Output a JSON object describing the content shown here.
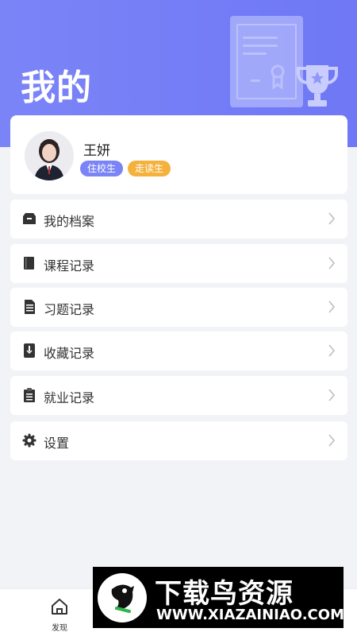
{
  "header": {
    "title": "我的"
  },
  "profile": {
    "name": "王妍",
    "badges": [
      "住校生",
      "走读生"
    ]
  },
  "menu": [
    {
      "label": "我的档案",
      "icon": "archive-box-icon"
    },
    {
      "label": "课程记录",
      "icon": "book-icon"
    },
    {
      "label": "习题记录",
      "icon": "document-list-icon"
    },
    {
      "label": "收藏记录",
      "icon": "bookmark-icon"
    },
    {
      "label": "就业记录",
      "icon": "clipboard-icon"
    },
    {
      "label": "设置",
      "icon": "gear-icon"
    }
  ],
  "bottom_nav": {
    "discover_label": "发现"
  },
  "watermark": {
    "title": "下载鸟资源",
    "url": "WWW.XIAZAINIAO.COM"
  },
  "colors": {
    "header_bg": "#7b84f7",
    "badge_resident": "#7b84f7",
    "badge_day": "#f4b13c"
  }
}
